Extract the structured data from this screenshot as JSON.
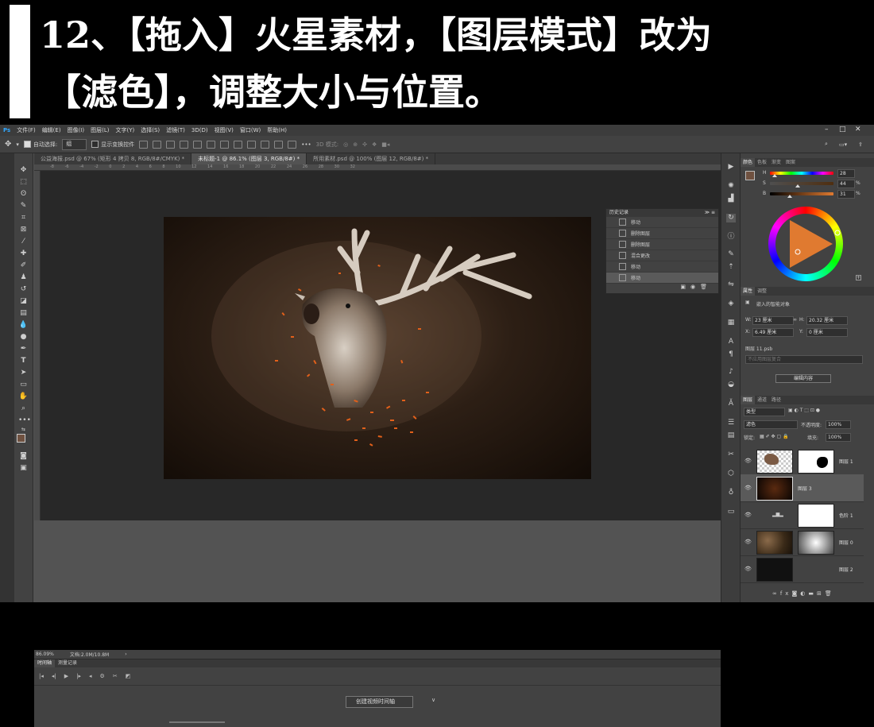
{
  "banner": {
    "line1": "12、【拖入】火星素材，【图层模式】改为",
    "line2": "【滤色】，调整大小与位置。"
  },
  "menu": [
    "文件(F)",
    "编辑(E)",
    "图像(I)",
    "图层(L)",
    "文字(Y)",
    "选择(S)",
    "滤镜(T)",
    "3D(D)",
    "视图(V)",
    "窗口(W)",
    "帮助(H)"
  ],
  "options": {
    "auto_select_label": "自动选择:",
    "auto_select_value": "组",
    "show_transform_label": "显示变换控件",
    "mode_3d": "3D 模式:"
  },
  "tabs": [
    "公益海报.psd @ 67% (矩形 4 拷贝 8, RGB/8#/CMYK) *",
    "未标题-1 @ 86.1% (图层 3, RGB/8#) *",
    "所用素材.psd @ 100% (图层 12, RGB/8#) *"
  ],
  "ruler_ticks": "-8  -6  -4  -2  0  2  4  6  8  10  12  14  16  18  20  22  24  26  28  30  32",
  "history": {
    "title": "历史记录",
    "items": [
      "移动",
      "删除图层",
      "删除图层",
      "混合更改",
      "移动",
      "移动"
    ]
  },
  "status": {
    "zoom": "86.09%",
    "doc": "文档:2.0M/10.8M"
  },
  "timeline": {
    "tab_timeline": "时间轴",
    "tab_measure": "测量记录",
    "create_button": "创建视频时间轴"
  },
  "color_panel": {
    "tabs": [
      "颜色",
      "色板",
      "渐变",
      "图案"
    ],
    "h_label": "H",
    "s_label": "S",
    "b_label": "B",
    "h_value": "28",
    "s_value": "44",
    "b_value": "31",
    "unit": "%",
    "h_fraction": 0.08,
    "s_fraction": 0.44,
    "b_fraction": 0.31
  },
  "properties": {
    "tabs": [
      "属性",
      "调整"
    ],
    "type_label": "嵌入的智能对象",
    "w_label": "W:",
    "w_value": "23 厘米",
    "h_label": "H:",
    "h_value": "20.32 厘米",
    "x_label": "X:",
    "x_value": "6.49 厘米",
    "y_label": "Y:",
    "y_value": "0 厘米",
    "file_label": "图层 11.psb",
    "comp_placeholder": "不应用图层复合",
    "edit_button": "编辑内容"
  },
  "layers_panel": {
    "tabs": [
      "图层",
      "通道",
      "路径"
    ],
    "filter_kind": "类型",
    "blend_mode": "滤色",
    "opacity_label": "不透明度:",
    "opacity_value": "100%",
    "lock_label": "锁定:",
    "fill_label": "填充:",
    "fill_value": "100%",
    "layers": [
      {
        "name": "图层 1",
        "selected": false
      },
      {
        "name": "图层 3",
        "selected": true
      },
      {
        "name": "色阶 1",
        "selected": false
      },
      {
        "name": "图层 0",
        "selected": false
      },
      {
        "name": "图层 2",
        "selected": false
      }
    ]
  }
}
